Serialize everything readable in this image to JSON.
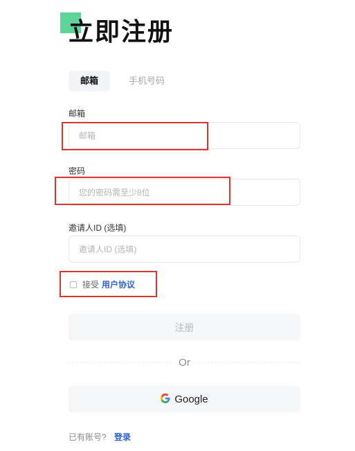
{
  "page": {
    "title": "立即注册"
  },
  "tabs": [
    {
      "label": "邮箱",
      "active": true
    },
    {
      "label": "手机号码",
      "active": false
    }
  ],
  "form": {
    "email": {
      "label": "邮箱",
      "placeholder": "邮箱",
      "value": ""
    },
    "password": {
      "label": "密码",
      "placeholder": "您的密码需至少8位",
      "value": ""
    },
    "invite": {
      "label": "邀请人ID (选填)",
      "placeholder": "邀请人ID (选填)",
      "value": ""
    }
  },
  "agreement": {
    "prefix": "接受",
    "link": "用户协议",
    "checked": false
  },
  "buttons": {
    "register": "注册",
    "divider": "Or",
    "google": "Google"
  },
  "footer": {
    "text": "已有账号?",
    "login": "登录"
  },
  "colors": {
    "accent": "#5fd49a",
    "link": "#2b63d9",
    "highlight": "#e0332b"
  }
}
